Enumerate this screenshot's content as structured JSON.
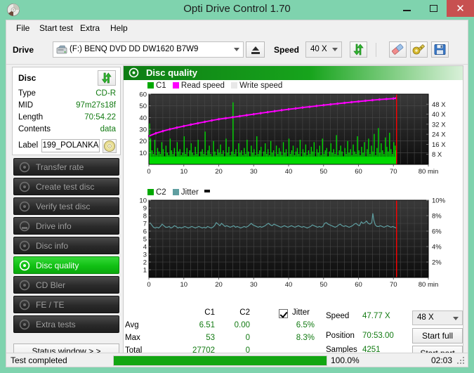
{
  "window": {
    "title": "Opti Drive Control 1.70",
    "icon": "disc-icon",
    "minimize": "–",
    "maximize": "□",
    "close": "✕",
    "titlebar_color": "#7fd3ae",
    "close_color": "#c75050"
  },
  "menu": [
    {
      "label": "File"
    },
    {
      "label": "Start test"
    },
    {
      "label": "Extra"
    },
    {
      "label": "Help"
    }
  ],
  "toolbar": {
    "drive_label": "Drive",
    "drive_value": "(F:)   BENQ DVD DD DW1620 B7W9",
    "eject_icon": "eject-icon",
    "speed_label": "Speed",
    "speed_value": "40 X",
    "refresh_icon": "refresh-icon",
    "eraser_icon": "eraser-icon",
    "tools_icon": "tools-icon",
    "save_icon": "save-icon"
  },
  "disc_panel": {
    "title": "Disc",
    "refresh_icon": "refresh-icon",
    "rows": [
      {
        "key": "Type",
        "value": "CD-R"
      },
      {
        "key": "MID",
        "value": "97m27s18f"
      },
      {
        "key": "Length",
        "value": "70:54.22"
      },
      {
        "key": "Contents",
        "value": "data"
      }
    ],
    "label_key": "Label",
    "label_value": "199_POLANKA",
    "label_disc_icon": "cd-icon"
  },
  "nav": {
    "items": [
      {
        "label": "Transfer rate",
        "icon": "disc-icon",
        "active": false
      },
      {
        "label": "Create test disc",
        "icon": "disc-icon",
        "active": false
      },
      {
        "label": "Verify test disc",
        "icon": "disc-icon",
        "active": false
      },
      {
        "label": "Drive info",
        "icon": "drive-icon",
        "active": false
      },
      {
        "label": "Disc info",
        "icon": "disc-icon",
        "active": false
      },
      {
        "label": "Disc quality",
        "icon": "disc-icon",
        "active": true
      },
      {
        "label": "CD Bler",
        "icon": "disc-icon",
        "active": false
      },
      {
        "label": "FE / TE",
        "icon": "disc-icon",
        "active": false
      },
      {
        "label": "Extra tests",
        "icon": "disc-icon",
        "active": false
      }
    ],
    "status_window": "Status window > >"
  },
  "main": {
    "header_title": "Disc quality",
    "header_icon": "disc-quality-icon"
  },
  "stats": {
    "col_c1": "C1",
    "col_c2": "C2",
    "jitter_label": "Jitter",
    "jitter_checked": true,
    "rows": [
      {
        "name": "Avg",
        "c1": "6.51",
        "c2": "0.00",
        "jitter": "6.5%"
      },
      {
        "name": "Max",
        "c1": "53",
        "c2": "0",
        "jitter": "8.3%"
      },
      {
        "name": "Total",
        "c1": "27702",
        "c2": "0",
        "jitter": ""
      }
    ],
    "speed_label": "Speed",
    "speed_value": "47.77 X",
    "position_label": "Position",
    "position_value": "70:53.00",
    "samples_label": "Samples",
    "samples_value": "4251",
    "speed_select": "48 X",
    "start_full": "Start full",
    "start_part": "Start part"
  },
  "statusbar": {
    "text": "Test completed",
    "percent_label": "100.0%",
    "percent_value": 100,
    "elapsed": "02:03"
  },
  "chart_data": [
    {
      "type": "area",
      "id": "c1-chart",
      "title": "",
      "legend": [
        {
          "name": "C1",
          "color": "#00a800"
        },
        {
          "name": "Read speed",
          "color": "#ff00ff"
        },
        {
          "name": "Write speed",
          "color": "#e8e8e8"
        }
      ],
      "legend_position": "top-left",
      "xlabel": "min",
      "xlim": [
        0,
        80
      ],
      "xticks": [
        0,
        10,
        20,
        30,
        40,
        50,
        60,
        70,
        80
      ],
      "ylabel": "",
      "ylim": [
        0,
        60
      ],
      "yticks": [
        10,
        20,
        30,
        40,
        50,
        60
      ],
      "y2label": "",
      "y2lim": [
        0,
        56
      ],
      "y2ticks": [
        8,
        16,
        24,
        32,
        40,
        48
      ],
      "y2ticklabels": [
        "8 X",
        "16 X",
        "24 X",
        "32 X",
        "40 X",
        "48 X"
      ],
      "grid": true,
      "marker_line_x": 70.9,
      "marker_line_color": "#ff0000",
      "background": "#141414",
      "series": [
        {
          "name": "C1",
          "type": "bar",
          "color": "#00d800",
          "x": [
            0.2,
            0.5,
            0.9,
            1.3,
            1.7,
            2.1,
            2.5,
            2.9,
            3.3,
            3.7,
            4.1,
            4.5,
            4.9,
            5.3,
            5.7,
            6.1,
            6.5,
            6.9,
            7.3,
            7.7,
            8.1,
            8.5,
            8.9,
            9.3,
            9.7,
            10.1,
            10.5,
            10.9,
            11.3,
            11.7,
            12.1,
            12.5,
            12.9,
            13.3,
            13.7,
            14.1,
            14.5,
            14.9,
            15.3,
            15.7,
            16.1,
            16.5,
            16.9,
            17.3,
            17.7,
            18.1,
            18.5,
            18.9,
            19.3,
            19.7,
            20.1,
            20.5,
            20.9,
            21.3,
            21.7,
            22.1,
            22.5,
            22.9,
            23.3,
            23.7,
            24.1,
            24.5,
            24.9,
            25.3,
            25.7,
            26.1,
            26.5,
            26.9,
            27.3,
            27.7,
            28.1,
            28.5,
            28.9,
            29.3,
            29.7,
            30.1,
            30.5,
            30.9,
            31.3,
            31.7,
            32.1,
            32.5,
            32.9,
            33.3,
            33.7,
            34.1,
            34.5,
            34.9,
            35.3,
            35.7,
            36.1,
            36.5,
            36.9,
            37.3,
            37.7,
            38.1,
            38.5,
            38.9,
            39.3,
            39.7,
            40.1,
            40.5,
            40.9,
            41.3,
            41.7,
            42.1,
            42.5,
            42.9,
            43.3,
            43.7,
            44.1,
            44.5,
            44.9,
            45.3,
            45.7,
            46.1,
            46.5,
            46.9,
            47.3,
            47.7,
            48.1,
            48.5,
            48.9,
            49.3,
            49.7,
            50.1,
            50.5,
            50.9,
            51.3,
            51.7,
            52.1,
            52.5,
            52.9,
            53.3,
            53.7,
            54.1,
            54.5,
            54.9,
            55.3,
            55.7,
            56.1,
            56.5,
            56.9,
            57.3,
            57.7,
            58.1,
            58.5,
            58.9,
            59.3,
            59.7,
            60.1,
            60.5,
            60.9,
            61.3,
            61.7,
            62.1,
            62.5,
            62.9,
            63.3,
            63.7,
            64.1,
            64.5,
            64.9,
            65.3,
            65.7,
            66.1,
            66.5,
            66.9,
            67.3,
            67.7,
            68.1,
            68.5,
            68.9,
            69.3,
            69.7,
            70.1,
            70.5,
            70.8
          ],
          "values": [
            35,
            22,
            12,
            9,
            21,
            8,
            14,
            11,
            9,
            19,
            13,
            7,
            16,
            10,
            8,
            22,
            12,
            9,
            14,
            7,
            19,
            11,
            13,
            8,
            10,
            24,
            9,
            14,
            7,
            12,
            18,
            10,
            8,
            15,
            9,
            21,
            7,
            11,
            13,
            9,
            28,
            8,
            12,
            16,
            9,
            7,
            20,
            11,
            8,
            13,
            10,
            17,
            9,
            12,
            7,
            22,
            10,
            15,
            8,
            11,
            53,
            9,
            13,
            7,
            18,
            10,
            12,
            8,
            14,
            9,
            21,
            11,
            7,
            16,
            10,
            13,
            8,
            24,
            9,
            12,
            15,
            7,
            11,
            18,
            9,
            13,
            8,
            20,
            10,
            12,
            7,
            16,
            9,
            14,
            11,
            8,
            19,
            10,
            13,
            7,
            22,
            9,
            12,
            16,
            8,
            11,
            14,
            9,
            21,
            7,
            13,
            10,
            17,
            8,
            12,
            9,
            15,
            11,
            19,
            7,
            13,
            10,
            16,
            8,
            22,
            9,
            12,
            14,
            7,
            11,
            18,
            10,
            13,
            9,
            25,
            8,
            12,
            16,
            11,
            7,
            14,
            9,
            20,
            10,
            13,
            8,
            17,
            11,
            9,
            24,
            12,
            8,
            15,
            10,
            19,
            7,
            13,
            22,
            9,
            16,
            11,
            26,
            8,
            14,
            31,
            10,
            18,
            12,
            9,
            23,
            15,
            11,
            27,
            13,
            9,
            19,
            16,
            12,
            22,
            10,
            25,
            14,
            37,
            28
          ],
          "avg": 6.51,
          "max": 53,
          "total": 27702
        },
        {
          "name": "Read speed",
          "type": "line",
          "color": "#ff00ff",
          "axis": "y2",
          "x": [
            0,
            2,
            4,
            6,
            8,
            10,
            12,
            14,
            16,
            18,
            20,
            22,
            24,
            26,
            28,
            30,
            32,
            34,
            36,
            38,
            40,
            42,
            44,
            46,
            48,
            50,
            52,
            54,
            56,
            58,
            60,
            62,
            64,
            66,
            68,
            70,
            70.8
          ],
          "values": [
            22.5,
            24.8,
            26.5,
            28.0,
            29.3,
            30.5,
            31.7,
            32.8,
            33.9,
            35.0,
            36.0,
            36.8,
            37.6,
            38.4,
            39.2,
            40.0,
            40.8,
            41.6,
            42.4,
            43.2,
            43.9,
            44.6,
            45.3,
            45.9,
            46.6,
            47.2,
            47.8,
            48.4,
            49.0,
            49.6,
            50.1,
            50.7,
            51.2,
            51.7,
            52.1,
            52.5,
            52.8
          ]
        },
        {
          "name": "Write speed",
          "type": "line",
          "color": "#e8e8e8",
          "x": [],
          "values": []
        }
      ]
    },
    {
      "type": "line",
      "id": "c2-jitter-chart",
      "title": "",
      "legend": [
        {
          "name": "C2",
          "color": "#00a800"
        },
        {
          "name": "Jitter",
          "color": "#5f9ea0"
        }
      ],
      "legend_position": "top-left",
      "xlabel": "min",
      "xlim": [
        0,
        80
      ],
      "xticks": [
        0,
        10,
        20,
        30,
        40,
        50,
        60,
        70,
        80
      ],
      "ylim": [
        0,
        10
      ],
      "yticks": [
        1,
        2,
        3,
        4,
        5,
        6,
        7,
        8,
        9,
        10
      ],
      "y2lim": [
        0,
        10
      ],
      "y2ticks": [
        2,
        4,
        6,
        8,
        10
      ],
      "y2ticklabels": [
        "2%",
        "4%",
        "6%",
        "8%",
        "10%"
      ],
      "grid": true,
      "marker_line_x": 70.9,
      "marker_line_color": "#ff0000",
      "background": "#141414",
      "series": [
        {
          "name": "C2",
          "type": "bar",
          "color": "#00d800",
          "x": [],
          "values": [],
          "avg": 0,
          "max": 0,
          "total": 0
        },
        {
          "name": "Jitter",
          "type": "line",
          "color": "#5f9ea0",
          "x": [
            0.3,
            0.8,
            1.3,
            1.8,
            2.3,
            2.8,
            3.3,
            3.8,
            4.3,
            4.8,
            5.3,
            5.8,
            6.3,
            6.8,
            7.3,
            7.8,
            8.3,
            8.8,
            9.3,
            9.8,
            10.3,
            10.8,
            11.3,
            11.8,
            12.3,
            12.8,
            13.3,
            13.8,
            14.3,
            14.8,
            15.3,
            15.8,
            16.3,
            16.8,
            17.3,
            17.8,
            18.3,
            18.8,
            19.3,
            19.8,
            20.3,
            20.8,
            21.3,
            21.8,
            22.3,
            22.8,
            23.3,
            23.8,
            24.3,
            24.8,
            25.3,
            25.8,
            26.3,
            26.8,
            27.3,
            27.8,
            28.3,
            28.8,
            29.3,
            29.8,
            30.3,
            30.8,
            31.3,
            31.8,
            32.3,
            32.8,
            33.3,
            33.8,
            34.3,
            34.8,
            35.3,
            35.8,
            36.3,
            36.8,
            37.3,
            37.8,
            38.3,
            38.8,
            39.3,
            39.8,
            40.3,
            40.8,
            41.3,
            41.8,
            42.3,
            42.8,
            43.3,
            43.8,
            44.3,
            44.8,
            45.3,
            45.8,
            46.3,
            46.8,
            47.3,
            47.8,
            48.3,
            48.8,
            49.3,
            49.8,
            50.3,
            50.8,
            51.3,
            51.8,
            52.3,
            52.8,
            53.3,
            53.8,
            54.3,
            54.8,
            55.3,
            55.8,
            56.3,
            56.8,
            57.3,
            57.8,
            58.3,
            58.8,
            59.3,
            59.8,
            60.3,
            60.8,
            61.3,
            61.8,
            62.3,
            62.8,
            63.3,
            63.8,
            64.1,
            64.4,
            64.8,
            65.3,
            65.8,
            66.3,
            66.8,
            67.3,
            67.8,
            68.3,
            68.8,
            69.3,
            69.8,
            70.3,
            70.8
          ],
          "values": [
            7.1,
            6.8,
            6.5,
            6.4,
            6.5,
            6.4,
            6.6,
            6.9,
            6.7,
            6.5,
            6.5,
            6.6,
            6.4,
            6.5,
            6.7,
            6.6,
            6.4,
            6.5,
            6.4,
            6.5,
            6.6,
            6.5,
            6.4,
            6.5,
            6.6,
            6.5,
            6.4,
            6.5,
            6.6,
            6.5,
            6.4,
            6.5,
            6.4,
            6.6,
            6.5,
            6.4,
            6.5,
            6.7,
            7.1,
            6.9,
            6.7,
            7.0,
            6.8,
            6.6,
            6.7,
            6.6,
            6.5,
            6.6,
            6.7,
            6.5,
            6.6,
            6.5,
            6.4,
            6.5,
            6.6,
            6.5,
            6.6,
            6.8,
            7.0,
            6.8,
            6.7,
            6.6,
            6.5,
            6.6,
            6.5,
            6.6,
            6.7,
            6.9,
            7.0,
            6.8,
            6.7,
            6.9,
            6.8,
            6.7,
            6.6,
            6.5,
            6.6,
            6.7,
            6.6,
            6.5,
            6.6,
            6.7,
            6.6,
            6.5,
            6.6,
            6.7,
            6.6,
            6.5,
            6.6,
            6.5,
            6.4,
            6.5,
            6.6,
            6.8,
            6.7,
            6.6,
            6.5,
            6.6,
            6.5,
            6.6,
            7.0,
            7.1,
            6.9,
            6.8,
            6.7,
            6.6,
            6.5,
            6.6,
            6.8,
            6.9,
            6.7,
            6.6,
            6.7,
            6.6,
            6.5,
            6.6,
            6.7,
            6.9,
            7.0,
            6.8,
            6.7,
            7.2,
            7.0,
            7.1,
            7.3,
            7.0,
            6.9,
            7.1,
            8.3,
            7.4,
            6.8,
            6.6,
            6.6,
            6.7,
            6.6,
            6.5,
            6.6,
            6.7,
            6.6,
            6.5,
            6.6,
            6.5,
            6.4,
            6.4
          ],
          "avg": 6.5,
          "max": 8.3
        }
      ]
    }
  ]
}
